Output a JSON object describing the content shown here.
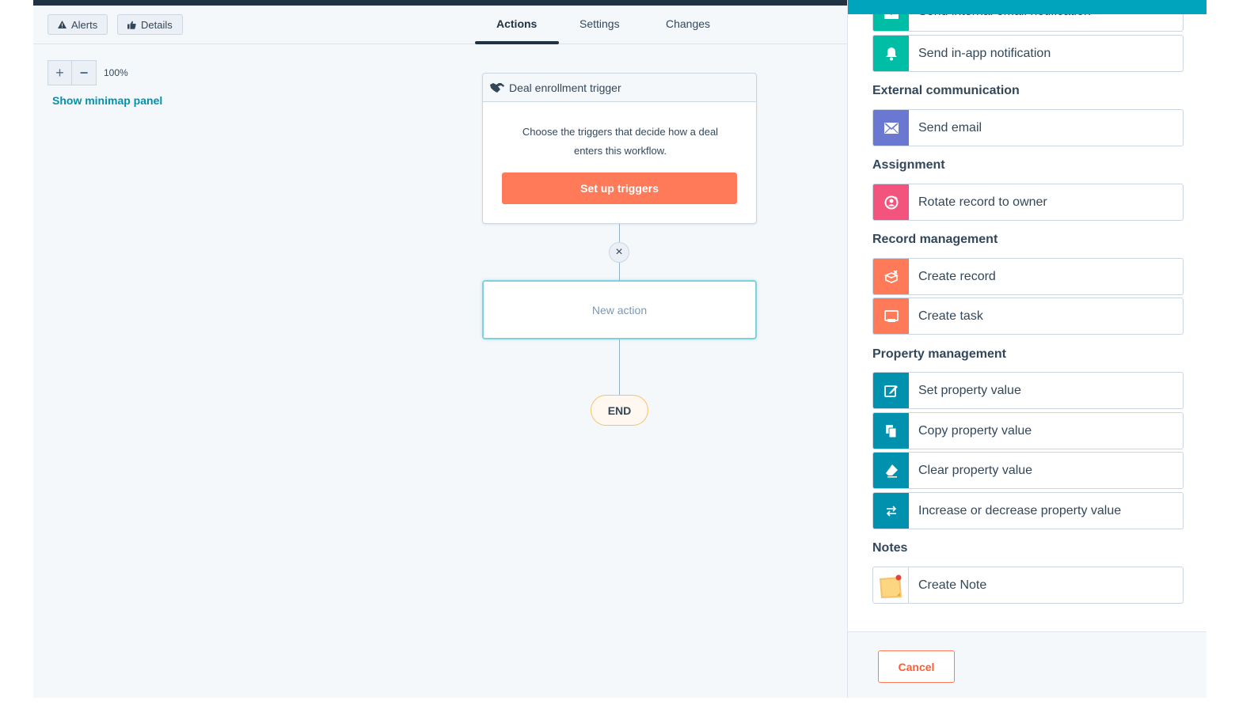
{
  "toolbar": {
    "alerts_label": "Alerts",
    "details_label": "Details"
  },
  "tabs": [
    {
      "label": "Actions",
      "active": true
    },
    {
      "label": "Settings",
      "active": false
    },
    {
      "label": "Changes",
      "active": false
    }
  ],
  "canvas": {
    "zoom_level": "100%",
    "minimap_link": "Show minimap panel",
    "trigger": {
      "title": "Deal enrollment trigger",
      "description_line1": "Choose the triggers that decide how a deal",
      "description_line2": "enters this workflow.",
      "button_label": "Set up triggers"
    },
    "new_action_label": "New action",
    "end_label": "END"
  },
  "panel": {
    "accent_color": "#00a4bd",
    "partial_item": "Send internal email notification",
    "items": {
      "send_in_app": "Send in-app notification",
      "send_email": "Send email",
      "rotate_record": "Rotate record to owner",
      "create_record": "Create record",
      "create_task": "Create task",
      "set_property": "Set property value",
      "copy_property": "Copy property value",
      "clear_property": "Clear property value",
      "increase_property": "Increase or decrease property value",
      "create_note": "Create Note"
    },
    "sections": {
      "external": "External communication",
      "assignment": "Assignment",
      "record_mgmt": "Record management",
      "property_mgmt": "Property management",
      "notes": "Notes"
    },
    "cancel_label": "Cancel"
  },
  "colors": {
    "internal": "#00bda5",
    "email": "#6a78d1",
    "assignment": "#f2547d",
    "record": "#ff7a59",
    "property": "#0091ae",
    "note": "#f5c26b",
    "primary_button": "#ff7a59"
  }
}
